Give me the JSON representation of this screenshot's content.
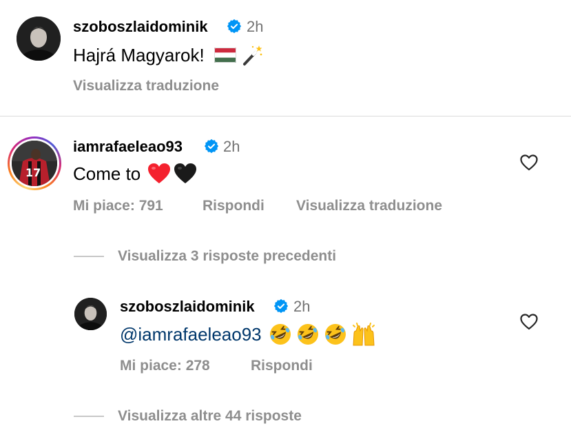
{
  "comments": [
    {
      "username": "szoboszlaidominik",
      "verified": true,
      "time": "2h",
      "text": "Hajrá Magyarok!",
      "emojis": [
        "hungary-flag",
        "magic-wand"
      ],
      "translate_label": "Visualizza traduzione"
    },
    {
      "username": "iamrafaeleao93",
      "verified": true,
      "time": "2h",
      "text": "Come to",
      "emojis": [
        "red-heart",
        "black-heart"
      ],
      "likes_label": "Mi piace: 791",
      "reply_label": "Rispondi",
      "translate_label": "Visualizza traduzione",
      "view_previous_label": "Visualizza 3 risposte precedenti",
      "reply": {
        "username": "szoboszlaidominik",
        "verified": true,
        "time": "2h",
        "mention": "@iamrafaeleao93",
        "emojis": [
          "rolling-laughing",
          "rolling-laughing",
          "rolling-laughing",
          "raising-hands"
        ],
        "likes_label": "Mi piace: 278",
        "reply_label": "Rispondi"
      },
      "view_more_label": "Visualizza altre 44 risposte"
    }
  ],
  "colors": {
    "secondary_text": "#8e8e8e",
    "mention": "#00376b",
    "verified_badge": "#0095f6"
  }
}
